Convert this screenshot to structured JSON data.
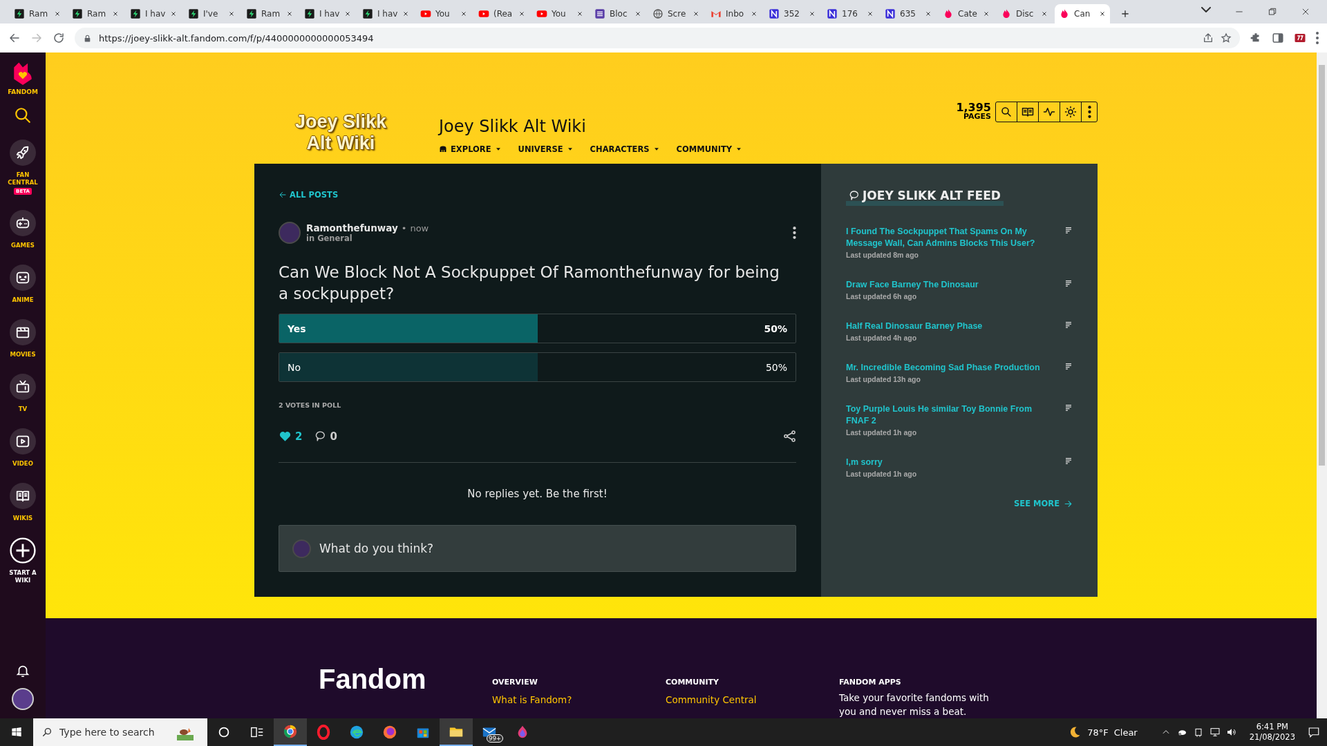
{
  "browser": {
    "tabs": [
      {
        "title": "Ram",
        "kind": "zap",
        "selected": false
      },
      {
        "title": "Ram",
        "kind": "zap",
        "selected": false
      },
      {
        "title": "I hav",
        "kind": "zap",
        "selected": false
      },
      {
        "title": "I've",
        "kind": "zap",
        "selected": false
      },
      {
        "title": "Ram",
        "kind": "zap",
        "selected": false
      },
      {
        "title": "I hav",
        "kind": "zap",
        "selected": false
      },
      {
        "title": "I hav",
        "kind": "zap",
        "selected": false
      },
      {
        "title": "You",
        "kind": "video",
        "selected": false
      },
      {
        "title": "(Rea",
        "kind": "video",
        "selected": false
      },
      {
        "title": "You",
        "kind": "video",
        "selected": false
      },
      {
        "title": "Bloc",
        "kind": "list",
        "selected": false
      },
      {
        "title": "Scre",
        "kind": "globe",
        "selected": false
      },
      {
        "title": "Inbo",
        "kind": "mail",
        "selected": false
      },
      {
        "title": "352",
        "kind": "n",
        "selected": false
      },
      {
        "title": "176",
        "kind": "n",
        "selected": false
      },
      {
        "title": "635",
        "kind": "n",
        "selected": false
      },
      {
        "title": "Cate",
        "kind": "flame",
        "selected": false
      },
      {
        "title": "Disc",
        "kind": "flame",
        "selected": false
      },
      {
        "title": "Can",
        "kind": "flame",
        "selected": true
      }
    ],
    "url": "https://joey-slikk-alt.fandom.com/f/p/4400000000000053494"
  },
  "sidebar": {
    "brand": "FANDOM",
    "items": [
      {
        "label": "FAN CENTRAL",
        "kind": "rocket",
        "badge": "BETA"
      },
      {
        "label": "GAMES",
        "kind": "gamepad"
      },
      {
        "label": "ANIME",
        "kind": "face"
      },
      {
        "label": "MOVIES",
        "kind": "clapper"
      },
      {
        "label": "TV",
        "kind": "tv"
      },
      {
        "label": "VIDEO",
        "kind": "play"
      },
      {
        "label": "WIKIS",
        "kind": "book"
      }
    ],
    "start": "START A WIKI"
  },
  "wiki": {
    "logo": "Joey Slikk Alt Wiki",
    "title": "Joey Slikk Alt Wiki",
    "nav": [
      "EXPLORE",
      "UNIVERSE",
      "CHARACTERS",
      "COMMUNITY"
    ],
    "pages_count": "1,395",
    "pages_label": "PAGES"
  },
  "post": {
    "back": "ALL POSTS",
    "author": "Ramonthefunway",
    "separator": "•",
    "time": "now",
    "category": "in General",
    "title": "Can We Block Not A Sockpuppet Of Ramonthefunway for being a sockpuppet?",
    "poll": [
      {
        "label": "Yes",
        "percent": "50%",
        "level": 0.5,
        "selected": true
      },
      {
        "label": "No",
        "percent": "50%",
        "level": 0.5,
        "selected": false
      }
    ],
    "votes": "2 VOTES IN POLL",
    "likes": "2",
    "liked": true,
    "comments": "0",
    "empty": "No replies yet. Be the first!",
    "reply_placeholder": "What do you think?"
  },
  "feed": {
    "title": "JOEY SLIKK ALT FEED",
    "items": [
      {
        "title": "I Found The Sockpuppet That Spams On My Message Wall, Can Admins Blocks This User?",
        "updated": "Last updated 8m ago"
      },
      {
        "title": "Draw Face Barney The Dinosaur",
        "updated": "Last updated 6h ago"
      },
      {
        "title": "Half Real Dinosaur Barney Phase",
        "updated": "Last updated 4h ago"
      },
      {
        "title": "Mr. Incredible Becoming Sad Phase Production",
        "updated": "Last updated 13h ago"
      },
      {
        "title": "Toy Purple Louis He similar Toy Bonnie From FNAF 2",
        "updated": "Last updated 1h ago"
      },
      {
        "title": "I,m sorry",
        "updated": "Last updated 1h ago"
      }
    ],
    "see_more": "SEE MORE"
  },
  "footer": {
    "brand": "Fandom",
    "columns": [
      {
        "heading": "OVERVIEW",
        "links": [
          "What is Fandom?"
        ]
      },
      {
        "heading": "COMMUNITY",
        "links": [
          "Community Central"
        ]
      }
    ],
    "apps_heading": "FANDOM APPS",
    "apps_text": "Take your favorite fandoms with you and never miss a beat."
  },
  "taskbar": {
    "search": "Type here to search",
    "mail_badge": "99+",
    "temperature": "78°F",
    "weather": "Clear",
    "time": "6:41 PM",
    "date": "21/08/2023"
  }
}
